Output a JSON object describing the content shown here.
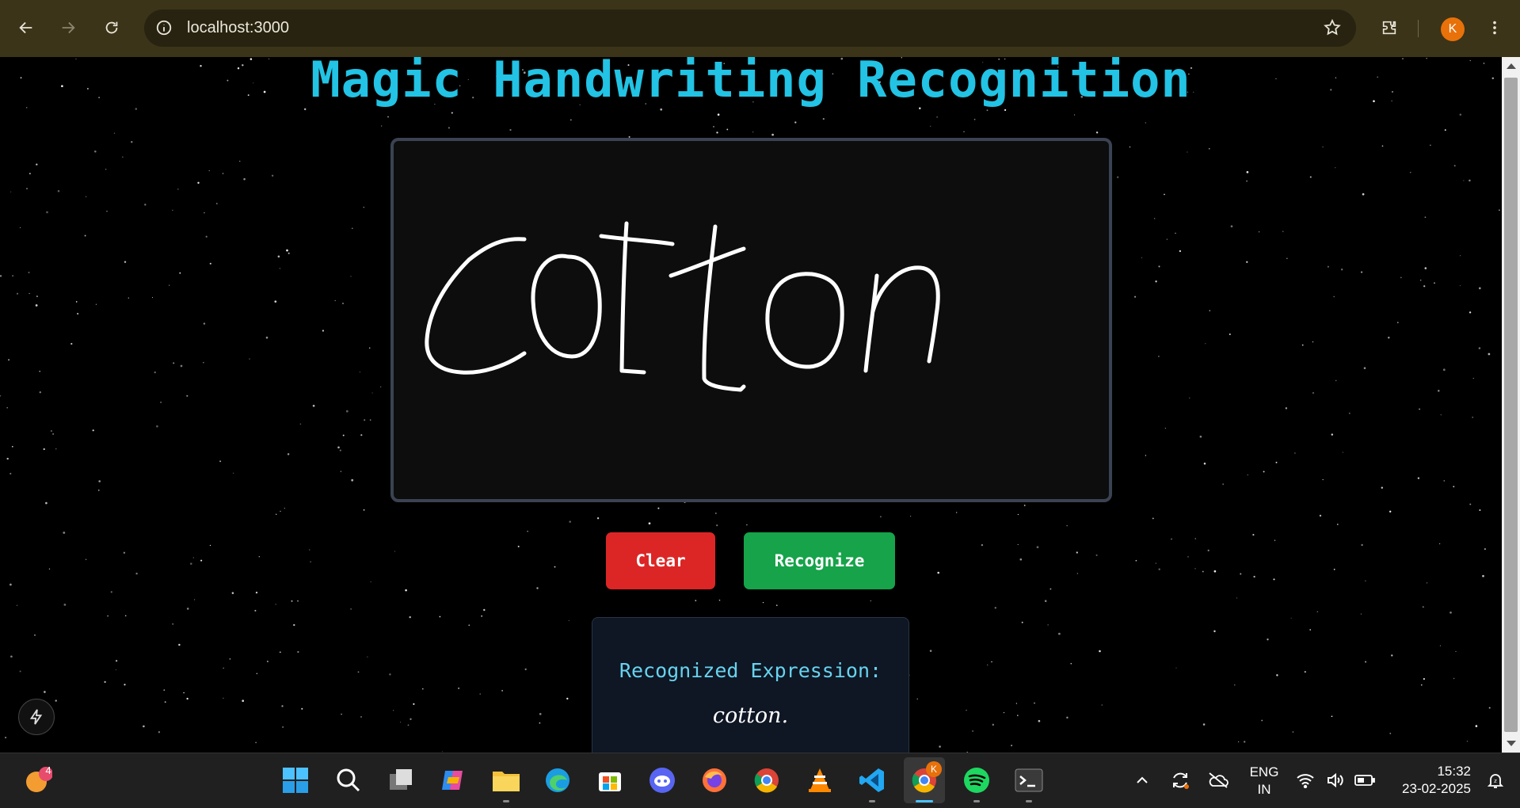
{
  "browser": {
    "url": "localhost:3000",
    "profile_initial": "K"
  },
  "page": {
    "title": "Magic Handwriting Recognition",
    "buttons": {
      "clear": "Clear",
      "recognize": "Recognize"
    },
    "result": {
      "label": "Recognized Expression:",
      "value": "cotton."
    }
  },
  "taskbar": {
    "notification_count": "4",
    "apps": [
      "start-icon",
      "search-icon",
      "task-view-icon",
      "copilot-icon",
      "file-explorer-icon",
      "edge-icon",
      "store-icon",
      "discord-icon",
      "firefox-icon",
      "chrome-icon",
      "vlc-icon",
      "vscode-icon",
      "chrome-profile-icon",
      "spotify-icon",
      "terminal-icon"
    ],
    "chrome_badge": "K",
    "language": "ENG",
    "region": "IN",
    "time": "15:32",
    "date": "23-02-2025"
  },
  "colors": {
    "title": "#22c3e4",
    "clear_button": "#dc2626",
    "recognize_button": "#16a34a",
    "result_label": "#67d3ee",
    "chrome_bg": "#3b3418"
  }
}
